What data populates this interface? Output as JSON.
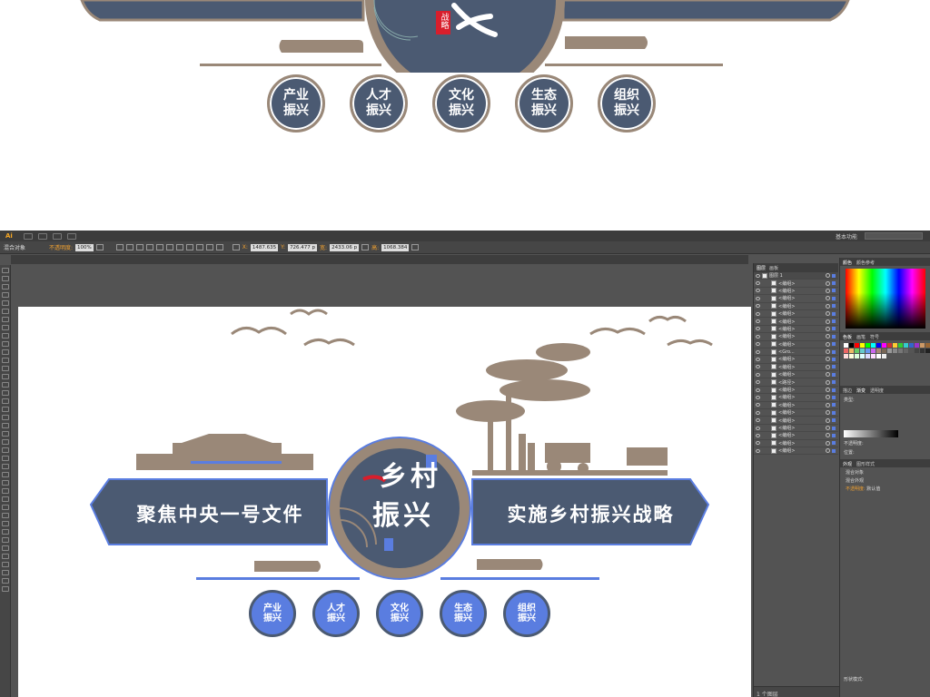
{
  "preview": {
    "red_seal": "战略",
    "badges": [
      {
        "l1": "产业",
        "l2": "振兴"
      },
      {
        "l1": "人才",
        "l2": "振兴"
      },
      {
        "l1": "文化",
        "l2": "振兴"
      },
      {
        "l1": "生态",
        "l2": "振兴"
      },
      {
        "l1": "组织",
        "l2": "振兴"
      }
    ]
  },
  "app": {
    "logo": "Ai",
    "workspace": "基本功能",
    "control": {
      "object_type": "混合对象",
      "opacity_label": "不透明度:",
      "opacity_value": "100%",
      "x_label": "X:",
      "x_value": "1487.635",
      "y_label": "Y:",
      "y_value": "726.477 p",
      "w_label": "宽:",
      "w_value": "2433.06 p",
      "h_label": "高:",
      "h_value": "1068.384"
    },
    "layers": {
      "tabs": [
        "图层",
        "画板"
      ],
      "top_layer": "图层 1",
      "rows": [
        "<编组>",
        "<编组>",
        "<编组>",
        "<编组>",
        "<编组>",
        "<编组>",
        "<编组>",
        "<编组>",
        "<编组>",
        "<Gro...",
        "<编组>",
        "<编组>",
        "<编组>",
        "<路径>",
        "<编组>",
        "<编组>",
        "<编组>",
        "<编组>",
        "<编组>",
        "<编组>",
        "<编组>",
        "<编组>",
        "<编组>"
      ],
      "footer": "1 个图层"
    },
    "color_panel": {
      "tabs": [
        "颜色",
        "颜色参考"
      ]
    },
    "swatch_panel": {
      "tabs": [
        "色板",
        "画笔",
        "符号"
      ]
    },
    "gradient_panel": {
      "tabs": [
        "描边",
        "渐变",
        "透明度"
      ],
      "type_label": "类型:",
      "opacity_label": "不透明度:",
      "position_label": "位置:"
    },
    "appearance_panel": {
      "tabs": [
        "外观",
        "图形样式"
      ],
      "object": "混合对象",
      "mixed": "混合外观",
      "opacity_label": "不透明度:",
      "opacity_value": "默认值"
    },
    "footer_left": "形状模式:"
  },
  "design": {
    "left_slogan": "聚焦中央一号文件",
    "right_slogan": "实施乡村振兴战略",
    "center_line1": "乡村",
    "center_line2": "振兴",
    "badges": [
      {
        "l1": "产业",
        "l2": "振兴"
      },
      {
        "l1": "人才",
        "l2": "振兴"
      },
      {
        "l1": "文化",
        "l2": "振兴"
      },
      {
        "l1": "生态",
        "l2": "振兴"
      },
      {
        "l1": "组织",
        "l2": "振兴"
      }
    ]
  },
  "colors": {
    "navy": "#4b5a72",
    "tan": "#9a8878",
    "selection_blue": "#5a7de0",
    "seal_red": "#d81e2c"
  }
}
